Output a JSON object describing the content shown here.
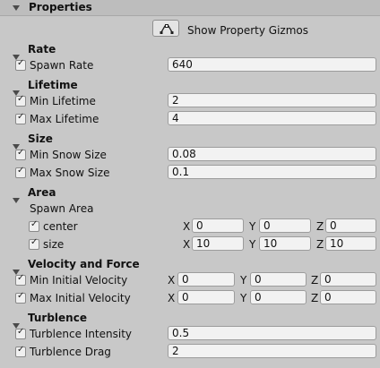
{
  "header": {
    "title": "Properties"
  },
  "toolbar": {
    "gizmo_label": "Show Property Gizmos",
    "gizmo_icon": "curve-edit-icon"
  },
  "sections": {
    "rate": {
      "title": "Rate",
      "spawn_rate": {
        "label": "Spawn Rate",
        "value": "640"
      }
    },
    "lifetime": {
      "title": "Lifetime",
      "min": {
        "label": "Min Lifetime",
        "value": "2"
      },
      "max": {
        "label": "Max Lifetime",
        "value": "4"
      }
    },
    "size": {
      "title": "Size",
      "min": {
        "label": "Min Snow Size",
        "value": "0.08"
      },
      "max": {
        "label": "Max Snow Size",
        "value": "0.1"
      }
    },
    "area": {
      "title": "Area",
      "spawn_area": "Spawn Area",
      "center": {
        "label": "center",
        "x": "0",
        "y": "0",
        "z": "0"
      },
      "size": {
        "label": "size",
        "x": "10",
        "y": "10",
        "z": "10"
      }
    },
    "velocity": {
      "title": "Velocity and Force",
      "min": {
        "label": "Min Initial Velocity",
        "x": "0",
        "y": "0",
        "z": "0"
      },
      "max": {
        "label": "Max Initial Velocity",
        "x": "0",
        "y": "0",
        "z": "0"
      }
    },
    "turbulence": {
      "title": "Turblence",
      "intensity": {
        "label": "Turblence Intensity",
        "value": "0.5"
      },
      "drag": {
        "label": "Turblence Drag",
        "value": "2"
      }
    }
  },
  "axes": {
    "x": "X",
    "y": "Y",
    "z": "Z"
  }
}
